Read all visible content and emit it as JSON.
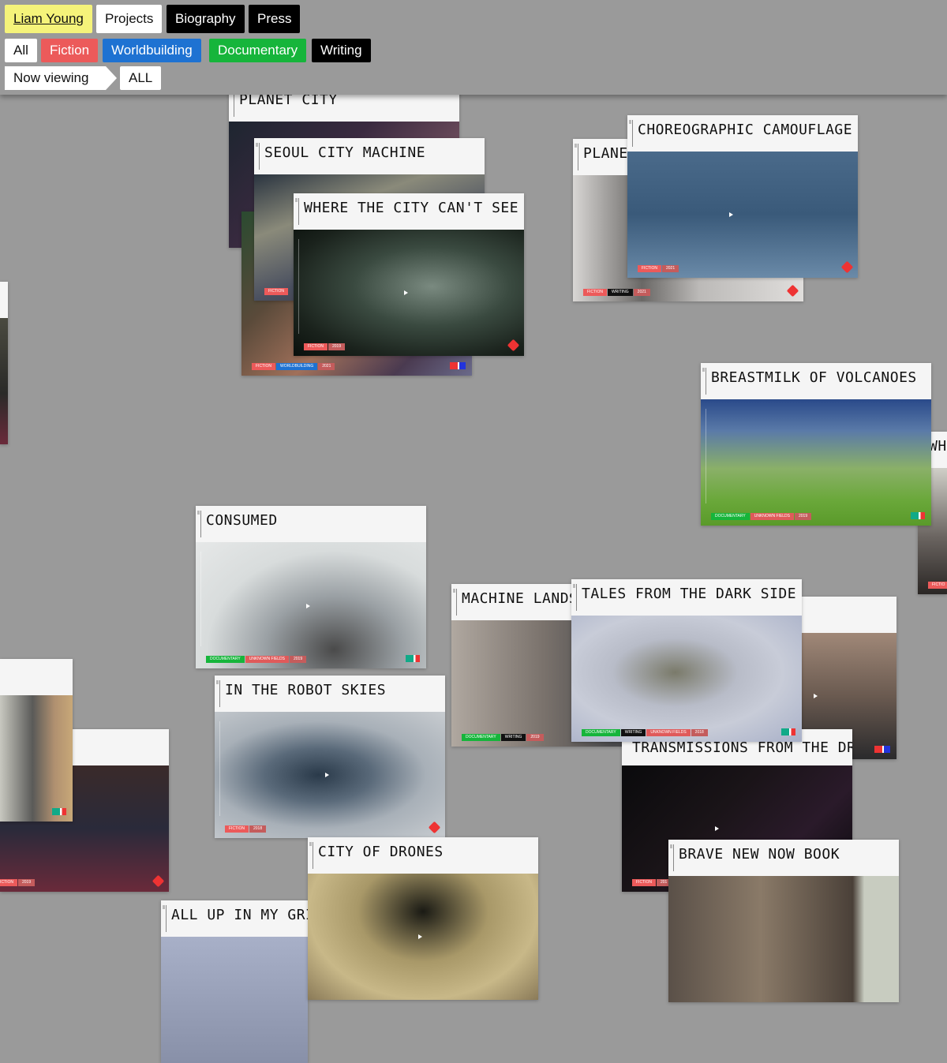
{
  "nav": {
    "primary": [
      {
        "label": "Liam Young",
        "bg": "#f5f37a",
        "fg": "#111"
      },
      {
        "label": "Projects",
        "bg": "#ffffff",
        "fg": "#111"
      },
      {
        "label": "Biography",
        "bg": "#000000",
        "fg": "#ffffff"
      },
      {
        "label": "Press",
        "bg": "#000000",
        "fg": "#ffffff"
      }
    ],
    "filters": [
      {
        "label": "All",
        "bg": "#ffffff",
        "fg": "#111"
      },
      {
        "label": "Fiction",
        "bg": "#ec5a5a",
        "fg": "#ffffff"
      },
      {
        "label": "Worldbuilding",
        "bg": "#1e72d2",
        "fg": "#ffffff"
      },
      {
        "label": "Documentary",
        "bg": "#16b53b",
        "fg": "#ffffff"
      },
      {
        "label": "Writing",
        "bg": "#000000",
        "fg": "#ffffff"
      }
    ],
    "now_viewing_label": "Now viewing",
    "now_viewing_value": "ALL"
  },
  "tag_colors": {
    "FICTION": "#ec5a5a",
    "WORLDBUILDING": "#1e72d2",
    "DOCUMENTARY": "#16b53b",
    "WRITING": "#111111",
    "UNKNOWN FIELDS": "#e05a5a",
    "YEAR": "#c45c5c"
  },
  "projects": [
    {
      "title": "PLANET CITY",
      "tags": [],
      "media": "linear-gradient(135deg,#1e2530,#3a2a40 40%,#6a4a5a 70%,#2a3040)"
    },
    {
      "title": "",
      "tags": [
        "FICTION",
        "WORLDBUILDING",
        "2021"
      ],
      "flag": "dd",
      "media": "linear-gradient(135deg,#2a4a30,#5a4a3a 30%,#a0705a 55%,#4a3a50 80%,#6a6a8a)"
    },
    {
      "title": "SEOUL CITY MACHINE",
      "tags": [
        "FICTION"
      ],
      "media": "linear-gradient(160deg,#2a3440,#8a8a7a 30%,#4a5060 60%,#3a2a30)"
    },
    {
      "title": "WHERE THE CITY CAN'T SEE",
      "tags": [
        "FICTION",
        "2019"
      ],
      "flag": "d",
      "media": "radial-gradient(ellipse at 60% 45%,#7a8a80,#3a4a40 40%,#1a221c 75%,#0a100c)"
    },
    {
      "title": "PLANE",
      "tags": [
        "FICTION",
        "WRITING",
        "2021"
      ],
      "flag": "d",
      "media": "linear-gradient(90deg,#d8d6d4,#6a6866 30%,#bcbab8 55%,#e0dedc)"
    },
    {
      "title": "CHOREOGRAPHIC CAMOUFLAGE",
      "tags": [
        "FICTION",
        "2021"
      ],
      "flag": "d",
      "media": "linear-gradient(180deg,#4a6a8a,#3a5a7a 50%,#6a8aa8)"
    },
    {
      "title": "",
      "tags": [],
      "media": "linear-gradient(180deg,#3a3a3a,#6a5a4a 60%,#2a2a2a)"
    },
    {
      "title": "BREASTMILK OF VOLCANOES",
      "tags": [
        "DOCUMENTARY",
        "UNKNOWN FIELDS",
        "2019"
      ],
      "flag": "ch",
      "media": "linear-gradient(180deg,#2a4a8a,#5a7aa8 25%,#8ab068 55%,#6aa83a 80%,#5a9a2a)"
    },
    {
      "title": "WH",
      "tags": [
        "FICTIO"
      ],
      "media": "linear-gradient(180deg,#d0cfc8,#6a6460 55%,#2a2624)"
    },
    {
      "title": "CONSUMED",
      "tags": [
        "DOCUMENTARY",
        "UNKNOWN FIELDS",
        "2019"
      ],
      "flag": "ch",
      "media": "radial-gradient(ellipse at 60% 85%,#4a4a4a,#9aa0a4 35%,#d8dcdc 65%,#e6e8e8)"
    },
    {
      "title": "MACHINE LANDS",
      "tags": [
        "DOCUMENTARY",
        "WRITING",
        "2019"
      ],
      "media": "linear-gradient(90deg,#b0a8a0,#7a726c 40%,#4a4a4c 70%)"
    },
    {
      "title": "",
      "tags": [],
      "flag": "dd",
      "media": "linear-gradient(180deg,#a08878,#6a5a50 50%,#2a2a2c)"
    },
    {
      "title": "TALES FROM THE DARK SIDE",
      "tags": [
        "DOCUMENTARY",
        "WRITING",
        "UNKNOWN FIELDS",
        "2018"
      ],
      "flag": "ch",
      "media": "radial-gradient(ellipse at 45% 45%,#7a7a6a,#b8bcc8 35%,#c8ccd8 60%,#a8b0c8)"
    },
    {
      "title": "",
      "tags": [],
      "flag": "ch",
      "media": "linear-gradient(90deg,#c8c8c0,#5a5a58 45%,#b09070 75%,#c8a878)"
    },
    {
      "title": "",
      "tags": [
        "FICTION",
        "2019"
      ],
      "flag": "d",
      "media": "linear-gradient(180deg,#3a2a2a,#2a2a3a 50%,#6a2a3a)"
    },
    {
      "title": "IN THE ROBOT SKIES",
      "tags": [
        "FICTION",
        "2018"
      ],
      "flag": "d",
      "media": "radial-gradient(ellipse at 45% 50%,#2a3a4a,#5a6a7a 30%,#a8b0b8 60%,#c8ccd0)"
    },
    {
      "title": "TRANSMISSIONS FROM THE DR",
      "tags": [
        "FICTION",
        "201"
      ],
      "media": "linear-gradient(135deg,#0a0a0c,#1a1418 40%,#2a1a2a 70%,#0a0a0c)"
    },
    {
      "title": "CITY OF DRONES",
      "tags": [],
      "media": "radial-gradient(ellipse at 50% 30%,#1a1a14,#a89868 40%,#c8b888 70%,#8a7a58)"
    },
    {
      "title": "BRAVE NEW NOW BOOK",
      "tags": [],
      "media": "linear-gradient(180deg,#5a5048,#8a7a68 40%,#4a4038)"
    },
    {
      "title": "ALL UP IN MY GRI",
      "tags": [],
      "media": "linear-gradient(180deg,#a8b0c8,#8890a8)"
    },
    {
      "title": "",
      "tags": [],
      "media": "linear-gradient(180deg,#4a4a40,#2a2a28 60%,#6a2a3a)"
    }
  ]
}
